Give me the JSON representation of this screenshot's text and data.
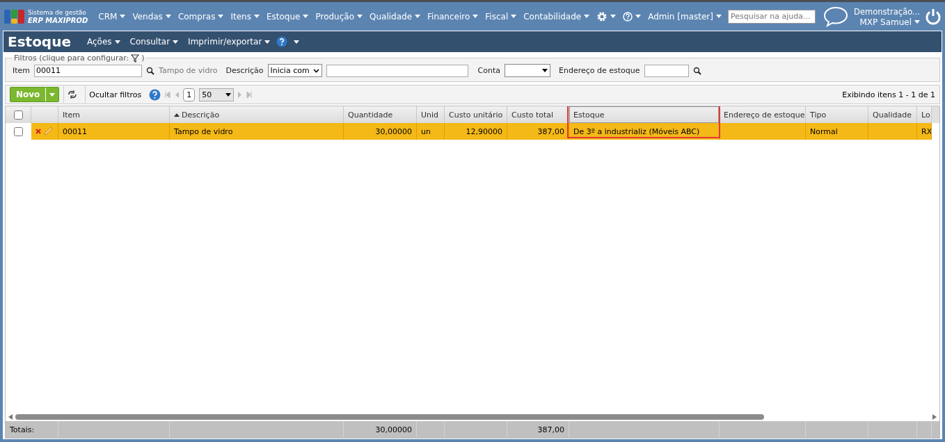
{
  "top_nav": {
    "logo": {
      "line1": "Sistema de gestão",
      "line2": "ERP MAXIPROD"
    },
    "menus": [
      "CRM",
      "Vendas",
      "Compras",
      "Itens",
      "Estoque",
      "Produção",
      "Qualidade",
      "Financeiro",
      "Fiscal",
      "Contabilidade"
    ],
    "user_menu": "Admin [master]",
    "search": {
      "placeholder": "Pesquisar na ajuda..."
    },
    "company": "Demonstração...",
    "user_name": "MXP Samuel"
  },
  "page": {
    "title": "Estoque",
    "menus": [
      "Ações",
      "Consultar",
      "Imprimir/exportar"
    ]
  },
  "filters": {
    "legend": "Filtros (clique para configurar:",
    "legend_end": ")",
    "item": {
      "label": "Item",
      "value": "00011",
      "lookup": "Tampo de vidro"
    },
    "descricao": {
      "label": "Descrição",
      "mode": "Inicia com"
    },
    "conta": {
      "label": "Conta"
    },
    "endereco": {
      "label": "Endereço de estoque"
    }
  },
  "toolbar": {
    "new": "Novo",
    "hide_filters": "Ocultar filtros",
    "page": "1",
    "page_size": "50",
    "summary": "Exibindo itens 1 - 1 de 1"
  },
  "table": {
    "columns": [
      {
        "label": "Item",
        "sorted": false,
        "highlighted": false
      },
      {
        "label": "Descrição",
        "sorted": true,
        "highlighted": false
      },
      {
        "label": "Quantidade",
        "sorted": false,
        "highlighted": false
      },
      {
        "label": "Unid",
        "sorted": false,
        "highlighted": false
      },
      {
        "label": "Custo unitário",
        "sorted": false,
        "highlighted": false
      },
      {
        "label": "Custo total",
        "sorted": false,
        "highlighted": false
      },
      {
        "label": "Estoque",
        "sorted": false,
        "highlighted": true
      },
      {
        "label": "Endereço de estoque",
        "sorted": false,
        "highlighted": false
      },
      {
        "label": "Tipo",
        "sorted": false,
        "highlighted": false
      },
      {
        "label": "Qualidade",
        "sorted": false,
        "highlighted": false
      },
      {
        "label": "Lo",
        "sorted": false,
        "highlighted": false
      }
    ],
    "all_checked": false,
    "rows": [
      {
        "checked": false,
        "selected": true,
        "cells": [
          "00011",
          "Tampo de vidro",
          "30,00000",
          "un",
          "12,90000",
          "387,00",
          "De 3º a industrializ (Móveis ABC)",
          "",
          "Normal",
          "",
          "RX"
        ]
      }
    ],
    "totals": {
      "label": "Totais:",
      "cells": [
        "",
        "",
        "30,00000",
        "",
        "",
        "387,00",
        "",
        "",
        "",
        "",
        ""
      ]
    }
  }
}
